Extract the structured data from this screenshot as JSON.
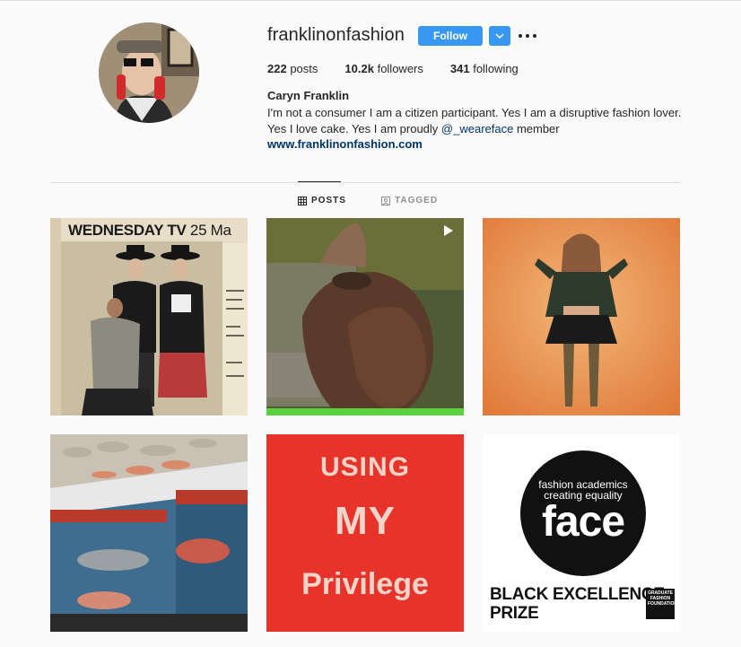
{
  "profile": {
    "username": "franklinonfashion",
    "follow_label": "Follow",
    "stats": {
      "posts_count": "222",
      "posts_label": "posts",
      "followers_count": "10.2k",
      "followers_label": "followers",
      "following_count": "341",
      "following_label": "following"
    },
    "full_name": "Caryn Franklin",
    "bio_line1": "I'm not a consumer I am a citizen participant. Yes I am a disruptive fashion lover.",
    "bio_line2_prefix": "Yes I love cake. Yes I am proudly ",
    "bio_mention": "@_weareface",
    "bio_line2_suffix": " member",
    "website": "www.franklinonfashion.com"
  },
  "tabs": {
    "posts": "POSTS",
    "tagged": "TAGGED"
  },
  "posts": {
    "tile1_heading": "WEDNESDAY TV",
    "tile1_date": " 25 Ma",
    "tile5_line1": "USING",
    "tile5_line2": "MY",
    "tile5_line3": "Privilege",
    "tile6_sub1": "fashion academics",
    "tile6_sub2": "creating equality",
    "tile6_word": "face",
    "tile6_prize1": "BLACK EXCELLENCE",
    "tile6_prize2": "PRIZE",
    "tile6_badge": "GRADUATE FASHION FOUNDATION"
  },
  "colors": {
    "accent": "#3897f0",
    "link": "#003569",
    "tile5_bg": "#e8332b"
  }
}
